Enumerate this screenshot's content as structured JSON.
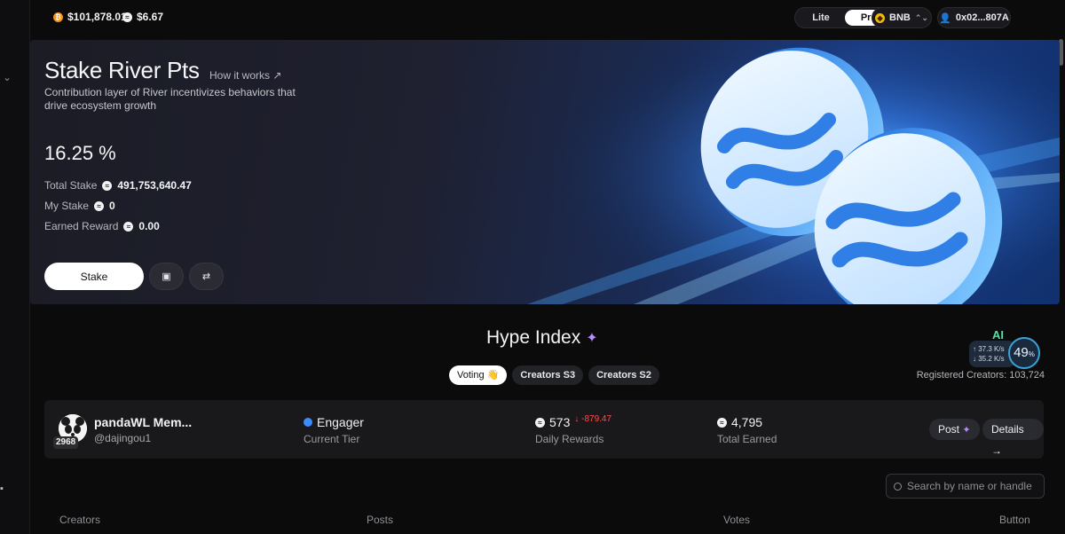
{
  "ticker": {
    "btc_price": "$101,878.01",
    "river_price": "$6.67"
  },
  "topbar": {
    "mode_lite": "Lite",
    "mode_pro": "Pro",
    "chain": "BNB",
    "wallet": "0x02...807A"
  },
  "hero": {
    "title": "Stake River Pts",
    "how_link": "How it works ↗",
    "description": "Contribution layer of River incentivizes behaviors that drive ecosystem growth",
    "apr": "16.25 %",
    "total_stake_label": "Total Stake",
    "total_stake_value": "491,753,640.47",
    "my_stake_label": "My Stake",
    "my_stake_value": "0",
    "earned_label": "Earned Reward",
    "earned_value": "0.00",
    "stake_button": "Stake"
  },
  "hype": {
    "title": "Hype Index",
    "tabs": [
      {
        "label": "Voting 👋",
        "active": true
      },
      {
        "label": "Creators S3",
        "active": false
      },
      {
        "label": "Creators S2",
        "active": false
      }
    ],
    "registered_creators": "Registered Creators: 103,724"
  },
  "ai_widget": {
    "label": "AI",
    "up_speed": "↑ 37.3 K/s",
    "down_speed": "↓ 35.2 K/s",
    "percent": "49",
    "percent_unit": "%"
  },
  "creator_card": {
    "rank": "2968",
    "name": "pandaWL Mem...",
    "handle": "@dajingou1",
    "tier": "Engager",
    "tier_label": "Current Tier",
    "daily_rewards": "573",
    "daily_delta": "↓ -879.47",
    "daily_label": "Daily Rewards",
    "total_earned": "4,795",
    "total_label": "Total Earned",
    "post_button": "Post",
    "details_button": "Details →"
  },
  "search": {
    "placeholder": "Search by name or handle"
  },
  "table_headers": {
    "creators": "Creators",
    "posts": "Posts",
    "votes": "Votes",
    "button": "Button"
  }
}
